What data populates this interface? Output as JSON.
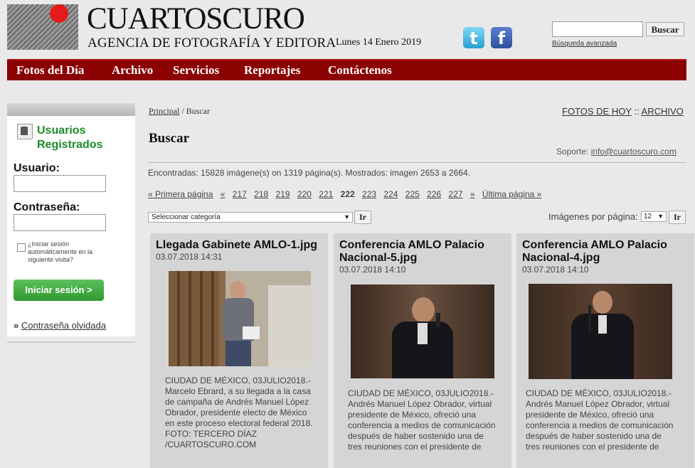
{
  "header": {
    "brand": "CUARTOSCURO",
    "brand_sub": "AGENCIA DE FOTOGRAFÍA Y EDITORA",
    "date": "Lunes 14 Enero 2019",
    "search_button": "Buscar",
    "advanced_search": "Búsqueda avanzada",
    "accent_color": "#e41b1b"
  },
  "nav": {
    "items": [
      "Fotos del Día",
      "Archivo",
      "Servicios",
      "Reportajes",
      "Contáctenos"
    ],
    "color": "#8b0000"
  },
  "sidebar": {
    "title": "Usuarios Registrados",
    "user_label": "Usuario:",
    "password_label": "Contraseña:",
    "auto_login": "¿Iniciar sesión automáticamente en la siguiente visita?",
    "login_button": "Iniciar sesión >",
    "forgot_prefix": "»",
    "forgot_link": "Contraseña olvidada"
  },
  "main": {
    "breadcrumb_home": "Principal",
    "breadcrumb_current": "/ Buscar",
    "fotos_hoy": "FOTOS DE HOY",
    "sep": "::",
    "archivo": "ARCHIVO",
    "title": "Buscar",
    "soporte_label": "Soporte:",
    "soporte_email": "info@cuartoscuro.com",
    "found": "Encontradas: 15828 imágene(s) on 1319 página(s). Mostrados: imagen 2653 a 2664.",
    "pager": {
      "first": "« Primera página",
      "prev": "«",
      "pages": [
        "217",
        "218",
        "219",
        "220",
        "221"
      ],
      "current": "222",
      "pages_after": [
        "223",
        "224",
        "225",
        "226",
        "227"
      ],
      "next": "»",
      "last": "Última página »"
    },
    "category_placeholder": "Seleccionar categoría",
    "go_label": "Ir",
    "per_page_label": "Imágenes por página:",
    "per_page_value": "12"
  },
  "cards": [
    {
      "title": "Llegada Gabinete AMLO-1.jpg",
      "date": "03.07.2018 14:31",
      "description": "CIUDAD DE MÉXICO, 03JULIO2018.- Marcelo Ebrard, a su llegada a la casa de campaña de Andrés Manuel López Obrador, presidente electo de México en este proceso electoral federal 2018. FOTO: TERCERO DÍAZ /CUARTOSCURO.COM"
    },
    {
      "title": "Conferencia AMLO Palacio Nacional-5.jpg",
      "date": "03.07.2018 14:10",
      "description": "CIUDAD DE MÉXICO, 03JULIO2018.- Andrés Manuel López Obrador, virtual presidente de México, ofreció una conferencia a medios de comunicación después de haber sostenido una de tres reuniones con el presidente de"
    },
    {
      "title": "Conferencia AMLO Palacio Nacional-4.jpg",
      "date": "03.07.2018 14:10",
      "description": "CIUDAD DE MÉXICO, 03JULIO2018.- Andrés Manuel López Obrador, virtual presidente de México, ofreció una conferencia a medios de comunicación después de haber sostenido una de tres reuniones con el presidente de"
    }
  ]
}
